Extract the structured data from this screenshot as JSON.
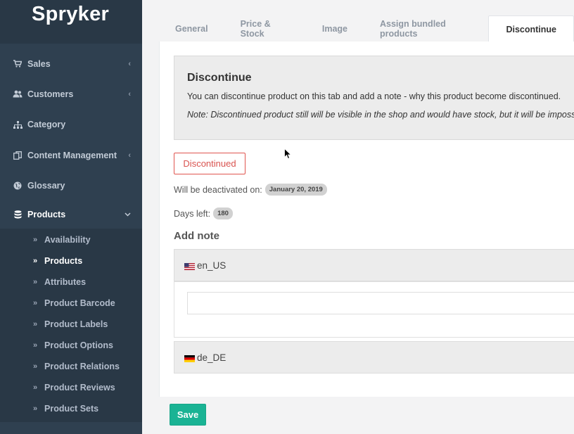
{
  "app": {
    "logo": "Spryker"
  },
  "sidebar": {
    "items": [
      {
        "label": "Sales",
        "icon": "cart-icon",
        "has_chevron": true
      },
      {
        "label": "Customers",
        "icon": "users-icon",
        "has_chevron": true
      },
      {
        "label": "Category",
        "icon": "sitemap-icon",
        "has_chevron": false
      },
      {
        "label": "Content Management",
        "icon": "files-icon",
        "has_chevron": true
      },
      {
        "label": "Glossary",
        "icon": "globe-icon",
        "has_chevron": false
      },
      {
        "label": "Products",
        "icon": "database-icon",
        "has_chevron": true,
        "expanded": true
      }
    ],
    "products_sub": [
      {
        "label": "Availability"
      },
      {
        "label": "Products",
        "active": true
      },
      {
        "label": "Attributes"
      },
      {
        "label": "Product Barcode"
      },
      {
        "label": "Product Labels"
      },
      {
        "label": "Product Options"
      },
      {
        "label": "Product Relations"
      },
      {
        "label": "Product Reviews"
      },
      {
        "label": "Product Sets"
      }
    ]
  },
  "tabs": [
    {
      "label": "General"
    },
    {
      "label": "Price & Stock"
    },
    {
      "label": "Image"
    },
    {
      "label": "Assign bundled products"
    },
    {
      "label": "Discontinue",
      "active": true
    }
  ],
  "notice": {
    "title": "Discontinue",
    "text": "You can discontinue product on this tab and add a note - why this product become discontinued.",
    "note": "Note: Discontinued product still will be visible in the shop and would have stock, but it will be impossible"
  },
  "discontinued_button": "Discontinued",
  "deactivation": {
    "label": "Will be deactivated on:",
    "date": "January 20, 2019"
  },
  "days_left": {
    "label": "Days left:",
    "value": "180"
  },
  "add_note_title": "Add note",
  "locales": [
    {
      "code": "en_US"
    },
    {
      "code": "de_DE"
    }
  ],
  "note_input_value": "",
  "save_button": "Save",
  "colors": {
    "sidebar": "#2f4050",
    "primary": "#1ab394",
    "danger": "#d9534f"
  }
}
